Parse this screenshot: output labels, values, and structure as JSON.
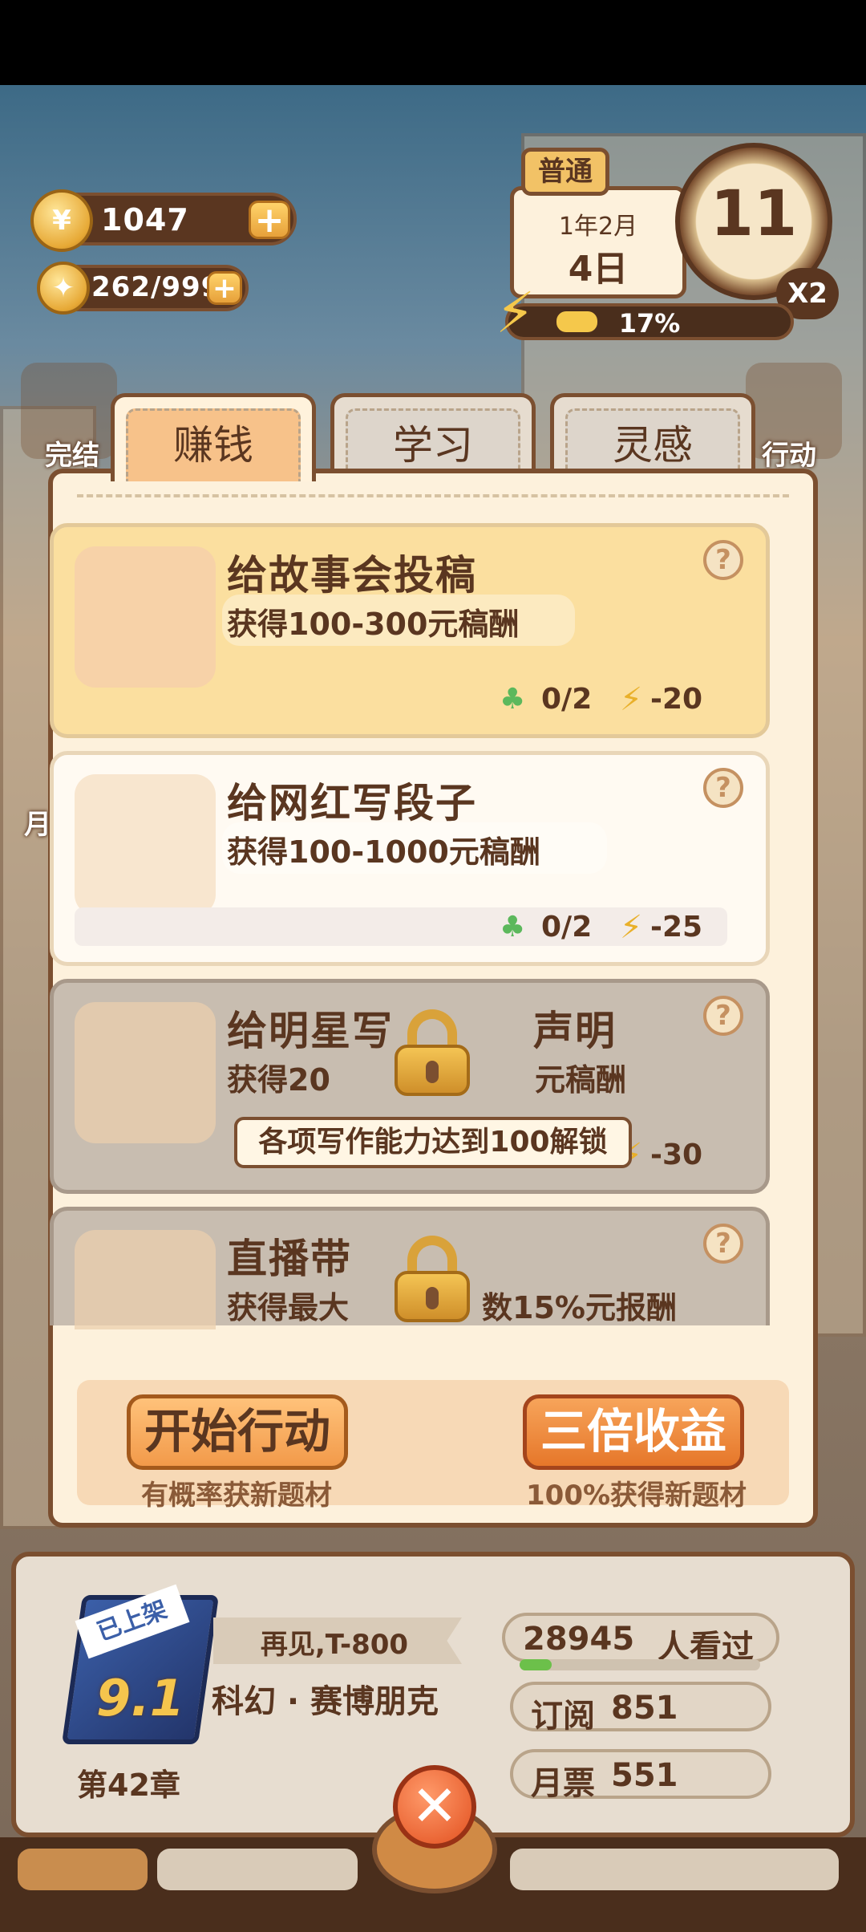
{
  "hud": {
    "coins": "1047",
    "inspiration": "262/999",
    "mode": "普通",
    "month": "1年2月",
    "day": "4日",
    "clock": "11",
    "speed": "X2",
    "energy_pct": "17%",
    "energy_fill_fraction": 0.17
  },
  "side": {
    "left_top": "完结",
    "right_top": "行动",
    "left_mid": "月"
  },
  "tabs": [
    {
      "label": "赚钱",
      "active": true
    },
    {
      "label": "学习",
      "active": false
    },
    {
      "label": "灵感",
      "active": false
    }
  ],
  "tasks": [
    {
      "title": "给故事会投稿",
      "reward": "获得100-300元稿酬",
      "clover": "0/2",
      "energy": "-20",
      "locked": false
    },
    {
      "title": "给网红写段子",
      "reward": "获得100-1000元稿酬",
      "clover": "0/2",
      "energy": "-25",
      "locked": false
    },
    {
      "title": "给明星写",
      "title_right": "声明",
      "reward": "获得20",
      "reward_right": "元稿酬",
      "energy": "-30",
      "locked": true
    },
    {
      "title": "直播带",
      "reward": "获得最大",
      "reward_right": "数15%元报酬",
      "locked": true
    }
  ],
  "unlock_tip": "各项写作能力达到100解锁",
  "actions": {
    "start_label": "开始行动",
    "start_sub": "有概率获新题材",
    "triple_label": "三倍收益",
    "triple_sub": "100%获得新题材"
  },
  "book": {
    "tag": "已上架",
    "score": "9.1",
    "title": "再见,T-800",
    "genre": "科幻 · 赛博朋克",
    "chapter": "第42章",
    "views": "28945",
    "views_label": "人看过",
    "subscribe_label": "订阅",
    "subscribe": "851",
    "ticket_label": "月票",
    "ticket": "551"
  },
  "close_label": "✕",
  "colors": {
    "accent": "#f29a4a",
    "brown": "#7b4f30",
    "gold": "#f5c84b"
  }
}
